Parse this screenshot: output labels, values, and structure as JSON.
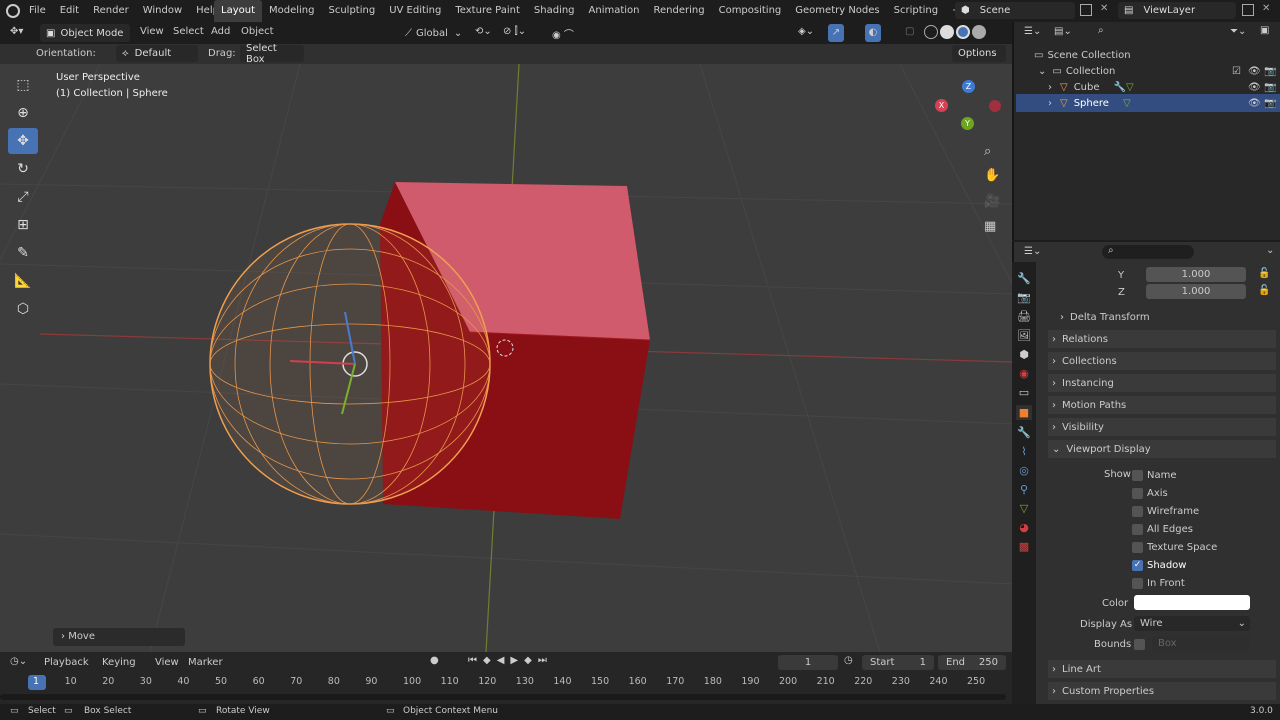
{
  "topmenu": [
    "File",
    "Edit",
    "Render",
    "Window",
    "Help"
  ],
  "workspaces": [
    "Layout",
    "Modeling",
    "Sculpting",
    "UV Editing",
    "Texture Paint",
    "Shading",
    "Animation",
    "Rendering",
    "Compositing",
    "Geometry Nodes",
    "Scripting",
    "+"
  ],
  "scene": "Scene",
  "viewlayer": "ViewLayer",
  "vp_header": {
    "mode": "Object Mode",
    "menus": [
      "View",
      "Select",
      "Add",
      "Object"
    ],
    "orientation": "Global",
    "options": "Options"
  },
  "tool_settings": {
    "orientation_label": "Orientation:",
    "orientation_value": "Default",
    "drag_label": "Drag:",
    "drag_value": "Select Box"
  },
  "viewport": {
    "line1": "User Perspective",
    "line2": "(1) Collection | Sphere",
    "last_op": "Move"
  },
  "gizmo": {
    "x": "X",
    "y": "Y",
    "z": "Z"
  },
  "outliner": {
    "root": "Scene Collection",
    "collection": "Collection",
    "items": [
      "Cube",
      "Sphere"
    ]
  },
  "props": {
    "y_label": "Y",
    "y_val": "1.000",
    "z_label": "Z",
    "z_val": "1.000",
    "sections": [
      "Delta Transform",
      "Relations",
      "Collections",
      "Instancing",
      "Motion Paths",
      "Visibility",
      "Viewport Display"
    ],
    "show_label": "Show",
    "checks": [
      {
        "label": "Name",
        "on": false
      },
      {
        "label": "Axis",
        "on": false
      },
      {
        "label": "Wireframe",
        "on": false
      },
      {
        "label": "All Edges",
        "on": false
      },
      {
        "label": "Texture Space",
        "on": false
      },
      {
        "label": "Shadow",
        "on": true
      },
      {
        "label": "In Front",
        "on": false
      }
    ],
    "color_label": "Color",
    "display_as_label": "Display As",
    "display_as": "Wire",
    "bounds_label": "Bounds",
    "bounds": "Box",
    "tail": [
      "Line Art",
      "Custom Properties"
    ]
  },
  "timeline": {
    "menus": [
      "Playback",
      "Keying",
      "View",
      "Marker"
    ],
    "frame": "1",
    "start_label": "Start",
    "start": "1",
    "end_label": "End",
    "end": "250",
    "ticks": [
      "1",
      "10",
      "20",
      "30",
      "40",
      "50",
      "60",
      "70",
      "80",
      "90",
      "100",
      "110",
      "120",
      "130",
      "140",
      "150",
      "160",
      "170",
      "180",
      "190",
      "200",
      "210",
      "220",
      "230",
      "240",
      "250"
    ]
  },
  "status": {
    "select": "Select",
    "box": "Box Select",
    "rotate": "Rotate View",
    "ctx": "Object Context Menu",
    "version": "3.0.0"
  }
}
